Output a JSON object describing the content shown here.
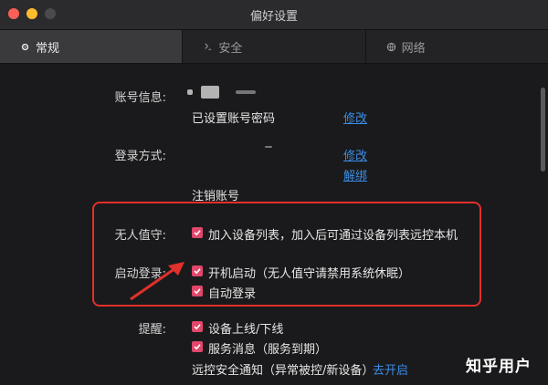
{
  "window": {
    "title": "偏好设置"
  },
  "tabs": [
    {
      "label": "常规",
      "icon": "gear-icon"
    },
    {
      "label": "安全",
      "icon": "shield-icon"
    },
    {
      "label": "网络",
      "icon": "globe-icon"
    }
  ],
  "account": {
    "label": "账号信息:",
    "password_status": "已设置账号密码",
    "modify_link": "修改"
  },
  "login": {
    "label": "登录方式:",
    "modify_link": "修改",
    "unbind_link": "解绑",
    "deregister": "注销账号"
  },
  "unattended": {
    "label": "无人值守:",
    "option": "加入设备列表，加入后可通过设备列表远控本机"
  },
  "startup": {
    "label": "启动登录:",
    "boot_start": "开机启动（无人值守请禁用系统休眠）",
    "auto_login": "自动登录"
  },
  "reminder": {
    "label": "提醒:",
    "device_online": "设备上线/下线",
    "service_msg": "服务消息（服务到期）",
    "security_notice": "远控安全通知（异常被控/新设备）",
    "enable_link": "去开启"
  },
  "watermark": "知乎用户",
  "colors": {
    "accent": "#e0476a",
    "link": "#3a8ee6",
    "highlight": "#e2302a"
  }
}
